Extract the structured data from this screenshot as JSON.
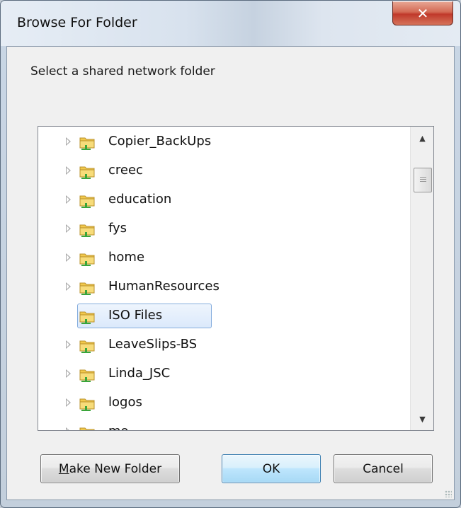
{
  "window": {
    "title": "Browse For Folder",
    "close_glyph": "✕"
  },
  "dialog": {
    "instruction": "Select a shared network folder"
  },
  "tree": {
    "items": [
      {
        "label": "Copier_BackUps",
        "expandable": true,
        "selected": false
      },
      {
        "label": "creec",
        "expandable": true,
        "selected": false
      },
      {
        "label": "education",
        "expandable": true,
        "selected": false
      },
      {
        "label": "fys",
        "expandable": true,
        "selected": false
      },
      {
        "label": "home",
        "expandable": true,
        "selected": false
      },
      {
        "label": "HumanResources",
        "expandable": true,
        "selected": false
      },
      {
        "label": "ISO Files",
        "expandable": false,
        "selected": true
      },
      {
        "label": "LeaveSlips-BS",
        "expandable": true,
        "selected": false
      },
      {
        "label": "Linda_JSC",
        "expandable": true,
        "selected": false
      },
      {
        "label": "logos",
        "expandable": true,
        "selected": false
      },
      {
        "label": "mo",
        "expandable": true,
        "selected": false
      }
    ]
  },
  "scrollbar": {
    "up_glyph": "▲",
    "down_glyph": "▼"
  },
  "buttons": {
    "make_new_folder_mnemonic": "M",
    "make_new_folder_rest": "ake New Folder",
    "ok": "OK",
    "cancel": "Cancel"
  },
  "colors": {
    "selection_border": "#84acdd",
    "close_button": "#c0392b",
    "folder_yellow": "#f2c94c",
    "share_green": "#3aa53a"
  }
}
